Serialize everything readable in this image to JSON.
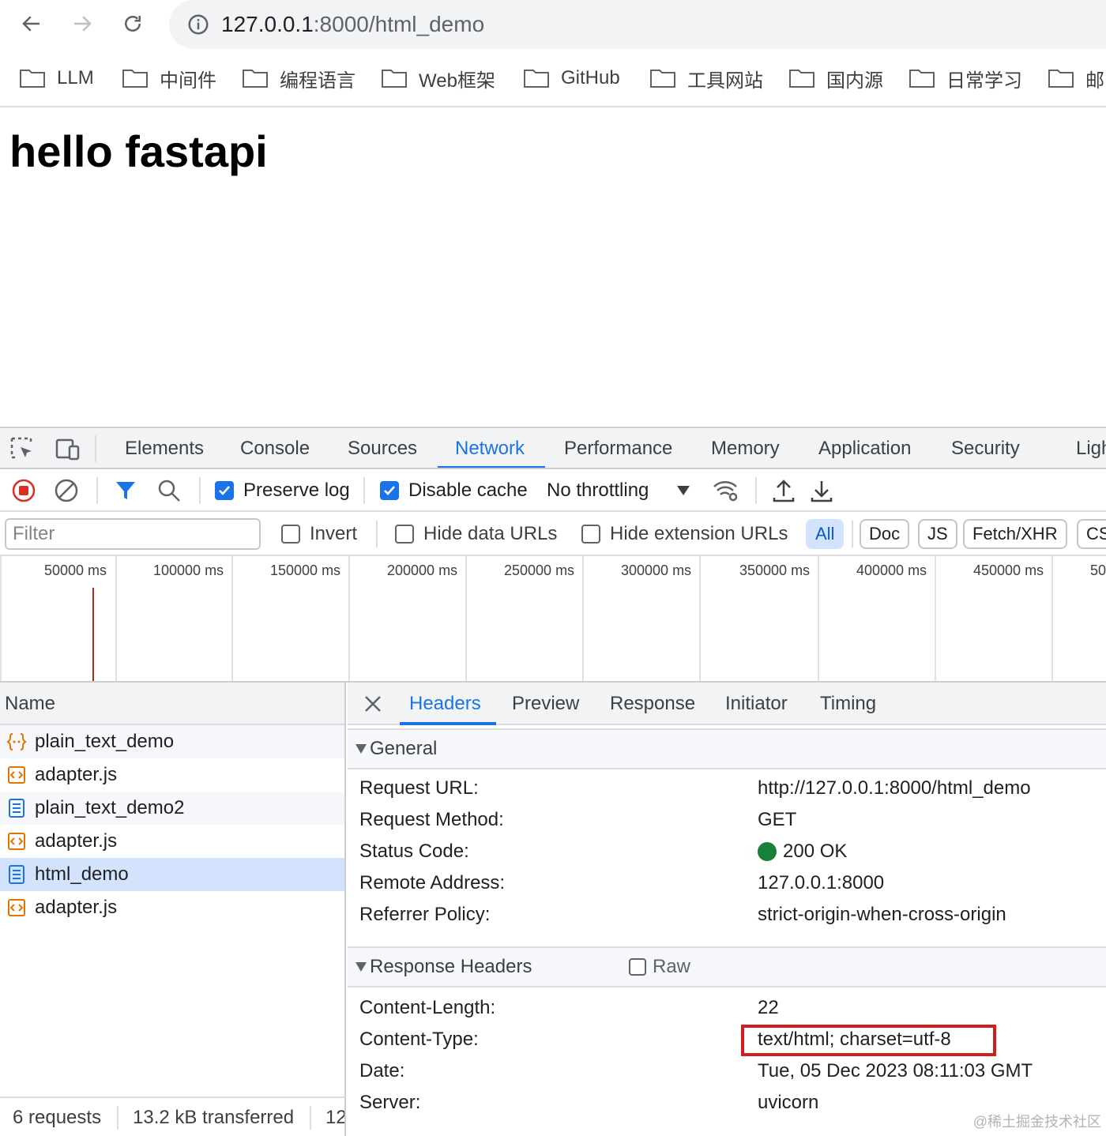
{
  "browser": {
    "url_host": "127.0.0.1",
    "url_path": ":8000/html_demo",
    "icons": {
      "back": "arrow-left-icon",
      "forward": "arrow-right-icon",
      "reload": "reload-icon",
      "info": "info-icon"
    },
    "bookmarks": [
      "LLM",
      "中间件",
      "编程语言",
      "Web框架",
      "GitHub",
      "工具网站",
      "国内源",
      "日常学习",
      "邮"
    ]
  },
  "page": {
    "heading": "hello fastapi"
  },
  "devtools": {
    "tabs": [
      "Elements",
      "Console",
      "Sources",
      "Network",
      "Performance",
      "Memory",
      "Application",
      "Security",
      "Ligh"
    ],
    "active_tab": "Network",
    "toolbar": {
      "preserve_log": "Preserve log",
      "preserve_log_checked": true,
      "disable_cache": "Disable cache",
      "disable_cache_checked": true,
      "throttling": "No throttling"
    },
    "filter": {
      "placeholder": "Filter",
      "invert": "Invert",
      "hide_data_urls": "Hide data URLs",
      "hide_extension_urls": "Hide extension URLs",
      "types": [
        "All",
        "Doc",
        "JS",
        "Fetch/XHR",
        "CS"
      ],
      "active_type": "All"
    },
    "overview_ticks": [
      "50000 ms",
      "100000 ms",
      "150000 ms",
      "200000 ms",
      "250000 ms",
      "300000 ms",
      "350000 ms",
      "400000 ms",
      "450000 ms",
      "50"
    ],
    "requests": {
      "header": "Name",
      "rows": [
        {
          "name": "plain_text_demo",
          "icon": "fetch-icon"
        },
        {
          "name": "adapter.js",
          "icon": "script-icon"
        },
        {
          "name": "plain_text_demo2",
          "icon": "document-icon"
        },
        {
          "name": "adapter.js",
          "icon": "script-icon"
        },
        {
          "name": "html_demo",
          "icon": "document-icon"
        },
        {
          "name": "adapter.js",
          "icon": "script-icon"
        }
      ],
      "selected_index": 4
    },
    "status_bar": {
      "requests": "6 requests",
      "transferred": "13.2 kB transferred",
      "resources": "12"
    },
    "details": {
      "tabs": [
        "Headers",
        "Preview",
        "Response",
        "Initiator",
        "Timing"
      ],
      "active_tab": "Headers",
      "general": {
        "title": "General",
        "rows": [
          {
            "key": "Request URL:",
            "value": "http://127.0.0.1:8000/html_demo"
          },
          {
            "key": "Request Method:",
            "value": "GET"
          },
          {
            "key": "Status Code:",
            "value": "200 OK"
          },
          {
            "key": "Remote Address:",
            "value": "127.0.0.1:8000"
          },
          {
            "key": "Referrer Policy:",
            "value": "strict-origin-when-cross-origin"
          }
        ]
      },
      "response_headers": {
        "title": "Response Headers",
        "raw_label": "Raw",
        "rows": [
          {
            "key": "Content-Length:",
            "value": "22"
          },
          {
            "key": "Content-Type:",
            "value": "text/html; charset=utf-8"
          },
          {
            "key": "Date:",
            "value": "Tue, 05 Dec 2023 08:11:03 GMT"
          },
          {
            "key": "Server:",
            "value": "uvicorn"
          }
        ]
      }
    }
  },
  "watermark": "@稀土掘金技术社区",
  "colors": {
    "accent": "#1a73e8",
    "status_ok": "#188038",
    "highlight": "#d01f1f",
    "record": "#d93025"
  }
}
